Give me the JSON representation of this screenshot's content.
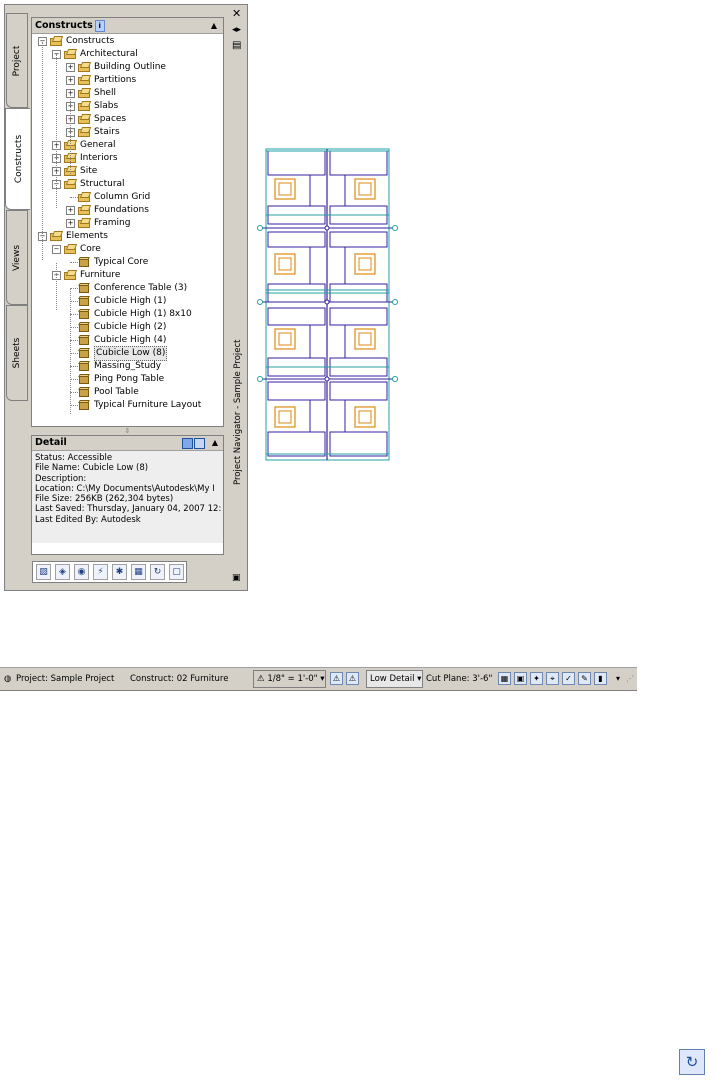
{
  "palette": {
    "tabs": [
      "Project",
      "Constructs",
      "Views",
      "Sheets"
    ],
    "tree_title": "Constructs",
    "tree": [
      {
        "label": "Constructs",
        "icon": "folder",
        "depth": 0,
        "toggle": "minus"
      },
      {
        "label": "Architectural",
        "icon": "folder",
        "depth": 1,
        "toggle": "minus"
      },
      {
        "label": "Building Outline",
        "icon": "folder",
        "depth": 2,
        "toggle": "plus"
      },
      {
        "label": "Partitions",
        "icon": "folder",
        "depth": 2,
        "toggle": "plus"
      },
      {
        "label": "Shell",
        "icon": "folder",
        "depth": 2,
        "toggle": "plus"
      },
      {
        "label": "Slabs",
        "icon": "folder",
        "depth": 2,
        "toggle": "plus"
      },
      {
        "label": "Spaces",
        "icon": "folder",
        "depth": 2,
        "toggle": "plus"
      },
      {
        "label": "Stairs",
        "icon": "folder",
        "depth": 2,
        "toggle": "plus"
      },
      {
        "label": "General",
        "icon": "folder",
        "depth": 1,
        "toggle": "plus"
      },
      {
        "label": "Interiors",
        "icon": "folder",
        "depth": 1,
        "toggle": "plus"
      },
      {
        "label": "Site",
        "icon": "folder",
        "depth": 1,
        "toggle": "plus"
      },
      {
        "label": "Structural",
        "icon": "folder",
        "depth": 1,
        "toggle": "minus"
      },
      {
        "label": "Column Grid",
        "icon": "folder",
        "depth": 2,
        "toggle": ""
      },
      {
        "label": "Foundations",
        "icon": "folder",
        "depth": 2,
        "toggle": "plus"
      },
      {
        "label": "Framing",
        "icon": "folder",
        "depth": 2,
        "toggle": "plus"
      },
      {
        "label": "Elements",
        "icon": "folder",
        "depth": 0,
        "toggle": "minus"
      },
      {
        "label": "Core",
        "icon": "folder",
        "depth": 1,
        "toggle": "minus"
      },
      {
        "label": "Typical Core",
        "icon": "cube",
        "depth": 2,
        "toggle": ""
      },
      {
        "label": "Furniture",
        "icon": "folder",
        "depth": 1,
        "toggle": "minus"
      },
      {
        "label": "Conference Table (3)",
        "icon": "cube",
        "depth": 2,
        "toggle": ""
      },
      {
        "label": "Cubicle High (1)",
        "icon": "cube",
        "depth": 2,
        "toggle": ""
      },
      {
        "label": "Cubicle High (1) 8x10",
        "icon": "cube",
        "depth": 2,
        "toggle": ""
      },
      {
        "label": "Cubicle High (2)",
        "icon": "cube",
        "depth": 2,
        "toggle": ""
      },
      {
        "label": "Cubicle High (4)",
        "icon": "cube",
        "depth": 2,
        "toggle": ""
      },
      {
        "label": "Cubicle Low (8)",
        "icon": "cube",
        "depth": 2,
        "toggle": "",
        "selected": true
      },
      {
        "label": "Massing_Study",
        "icon": "cube",
        "depth": 2,
        "toggle": ""
      },
      {
        "label": "Ping Pong Table",
        "icon": "cube",
        "depth": 2,
        "toggle": ""
      },
      {
        "label": "Pool Table",
        "icon": "cube",
        "depth": 2,
        "toggle": ""
      },
      {
        "label": "Typical Furniture Layout",
        "icon": "cube",
        "depth": 2,
        "toggle": ""
      }
    ],
    "detail": {
      "title": "Detail",
      "lines": [
        "Status: Accessible",
        "File Name: Cubicle Low (8)",
        "Description:",
        "Location: C:\\My Documents\\Autodesk\\My I",
        "File Size: 256KB (262,304 bytes)",
        "Last Saved: Thursday, January 04, 2007  12:",
        "Last Edited By: Autodesk"
      ]
    },
    "toolbar_icons": [
      "add-icon",
      "add-component-icon",
      "open-icon",
      "xref-icon",
      "remote-icon",
      "sheet-icon",
      "repath-icon",
      "close-icon"
    ],
    "side_title": "Project Navigator - Sample Project"
  },
  "statusbar": {
    "project": "Project: Sample Project",
    "construct": "Construct: 02 Furniture",
    "scale": "1/8\" = 1'-0\"",
    "detail_level": "Low Detail",
    "cut_plane": "Cut Plane: 3'-6\""
  },
  "colors": {
    "accent": "#2050a0",
    "desk": "#3a1fa0",
    "chair": "#e08a10",
    "panel": "#20a0a0"
  }
}
